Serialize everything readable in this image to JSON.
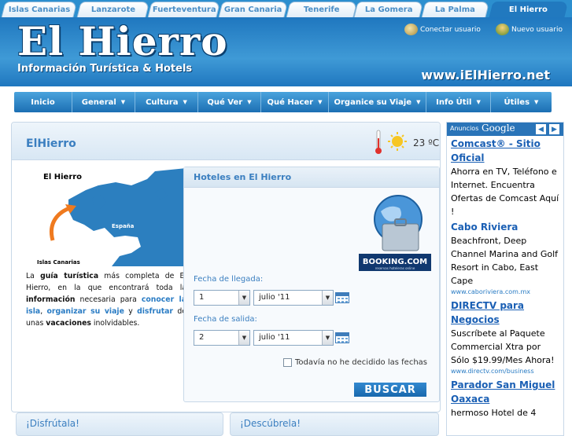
{
  "tabs": [
    "Islas Canarias",
    "Lanzarote",
    "Fuerteventura",
    "Gran Canaria",
    "Tenerife",
    "La Gomera",
    "La Palma",
    "El Hierro"
  ],
  "header": {
    "title": "El Hierro",
    "subtitle": "Información Turística & Hotels",
    "url": "www.iElHierro.net",
    "connect": "Conectar usuario",
    "new_user": "Nuevo usuario"
  },
  "nav": [
    "Inicio",
    "General",
    "Cultura",
    "Qué Ver",
    "Qué Hacer",
    "Organice su Viaje",
    "Info Útil",
    "Útiles"
  ],
  "main": {
    "title": "ElHierro",
    "temperature": "23 ºC",
    "map": {
      "label": "El Hierro",
      "country": "España",
      "caption": "Islas Canarias"
    },
    "intro": {
      "t1": "La ",
      "b1": "guía turística",
      "t2": " más completa de El Hierro, en la que encontrará toda la ",
      "b2": "información",
      "t3": " necesaria para ",
      "l1": "conocer la isla",
      "t4": ", ",
      "l2": "organizar su viaje",
      "t5": " y ",
      "l3": "disfrutar",
      "t6": " de unas ",
      "b3": "vacaciones",
      "t7": " inolvidables."
    }
  },
  "hotels": {
    "title": "Hoteles en El Hierro",
    "booking_logo": "BOOKING.COM",
    "booking_sub": "reservas hoteleras online",
    "arrival_label": "Fecha de llegada:",
    "arrival_day": "1",
    "arrival_month": "julio '11",
    "departure_label": "Fecha de salida:",
    "departure_day": "2",
    "departure_month": "julio '11",
    "undecided": "Todavía no he decidido las fechas",
    "search": "BUSCAR"
  },
  "bottom": {
    "left": "¡Disfrútala!",
    "right": "¡Descúbrela!"
  },
  "ads": {
    "label": "Anuncios",
    "brand": "Google",
    "items": [
      {
        "title": "Comcast® - Sitio Oficial",
        "text": "Ahorra en TV, Teléfono e Internet. Encuentra Ofertas de Comcast Aquí !",
        "url": ""
      },
      {
        "title": "Cabo Riviera",
        "text": "Beachfront, Deep Channel Marina and Golf Resort in Cabo, East Cape",
        "url": "www.caboriviera.com.mx"
      },
      {
        "title": "DIRECTV para Negocios",
        "text": "Suscríbete al Paquete Commercial Xtra por Sólo $19.99/Mes Ahora!",
        "url": "www.directv.com/business"
      },
      {
        "title": "Parador San Miguel Oaxaca",
        "text": "hermoso Hotel de 4",
        "url": ""
      }
    ]
  },
  "colors": {
    "brand_blue": "#1f77bf",
    "link_blue": "#2a7cc4",
    "heading_blue": "#3b7fc0"
  }
}
